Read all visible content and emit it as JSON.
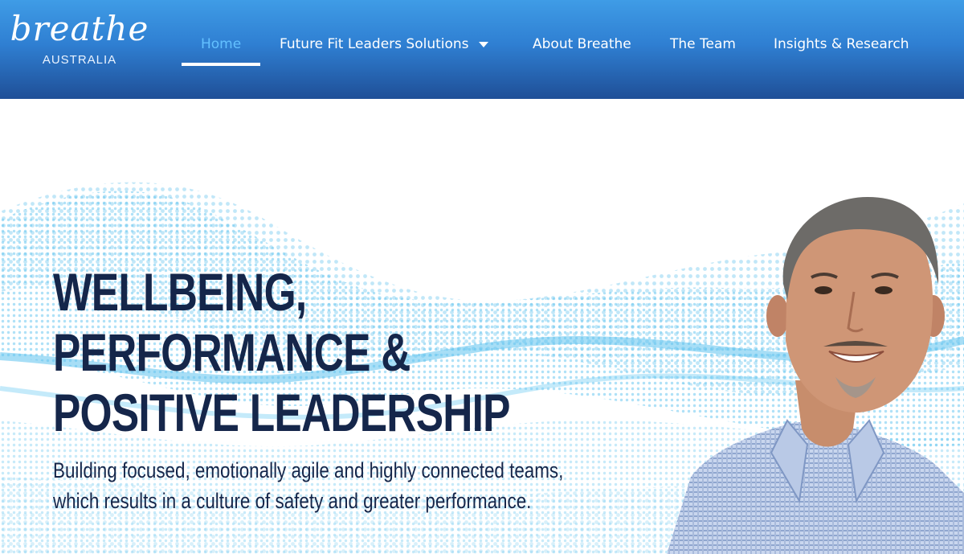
{
  "brand": {
    "name": "breathe",
    "region": "AUSTRALIA"
  },
  "nav": {
    "items": [
      {
        "label": "Home",
        "active": true
      },
      {
        "label": "Future Fit Leaders Solutions",
        "has_dropdown": true
      },
      {
        "label": "About Breathe"
      },
      {
        "label": "The Team"
      },
      {
        "label": "Insights & Research"
      }
    ]
  },
  "hero": {
    "title_lines": [
      "WELLBEING,",
      "PERFORMANCE &",
      "POSITIVE LEADERSHIP"
    ],
    "subtitle_lines": [
      "Building focused, emotionally agile and highly connected teams,",
      "which results in a culture of safety and greater performance."
    ]
  },
  "colors": {
    "header_top": "#3f9ce6",
    "header_bottom": "#1f4f97",
    "nav_active": "#63c0ff",
    "heading": "#15264a",
    "wave": "#5fc3ee"
  }
}
